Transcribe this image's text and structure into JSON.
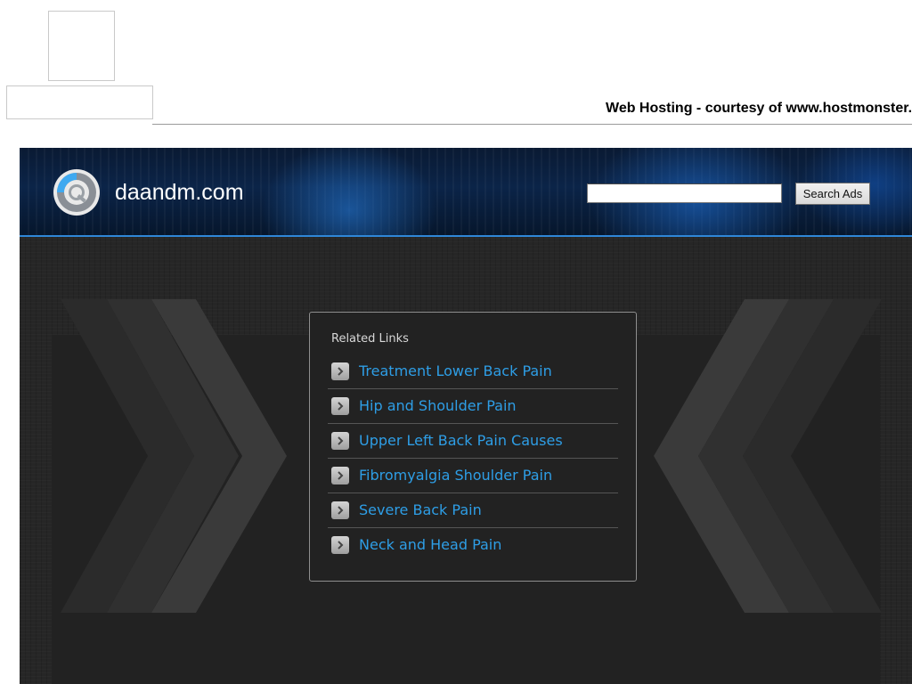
{
  "hosting": {
    "text": "Web Hosting - courtesy of www.hostmonster.com"
  },
  "header": {
    "site_name": "daandm.com",
    "search_input": {
      "value": "",
      "placeholder": ""
    },
    "search_button_label": "Search Ads"
  },
  "related_links": {
    "title": "Related Links",
    "items": [
      {
        "label": "Treatment Lower Back Pain"
      },
      {
        "label": "Hip and Shoulder Pain"
      },
      {
        "label": "Upper Left Back Pain Causes"
      },
      {
        "label": "Fibromyalgia Shoulder Pain"
      },
      {
        "label": "Severe Back Pain"
      },
      {
        "label": "Neck and Head Pain"
      }
    ]
  },
  "colors": {
    "link": "#2e9ee6",
    "header_rule": "#2f87d8",
    "body_bg": "#262626"
  },
  "icons": {
    "logo": "target-logo-icon",
    "link_arrow": "chevron-right-icon"
  }
}
